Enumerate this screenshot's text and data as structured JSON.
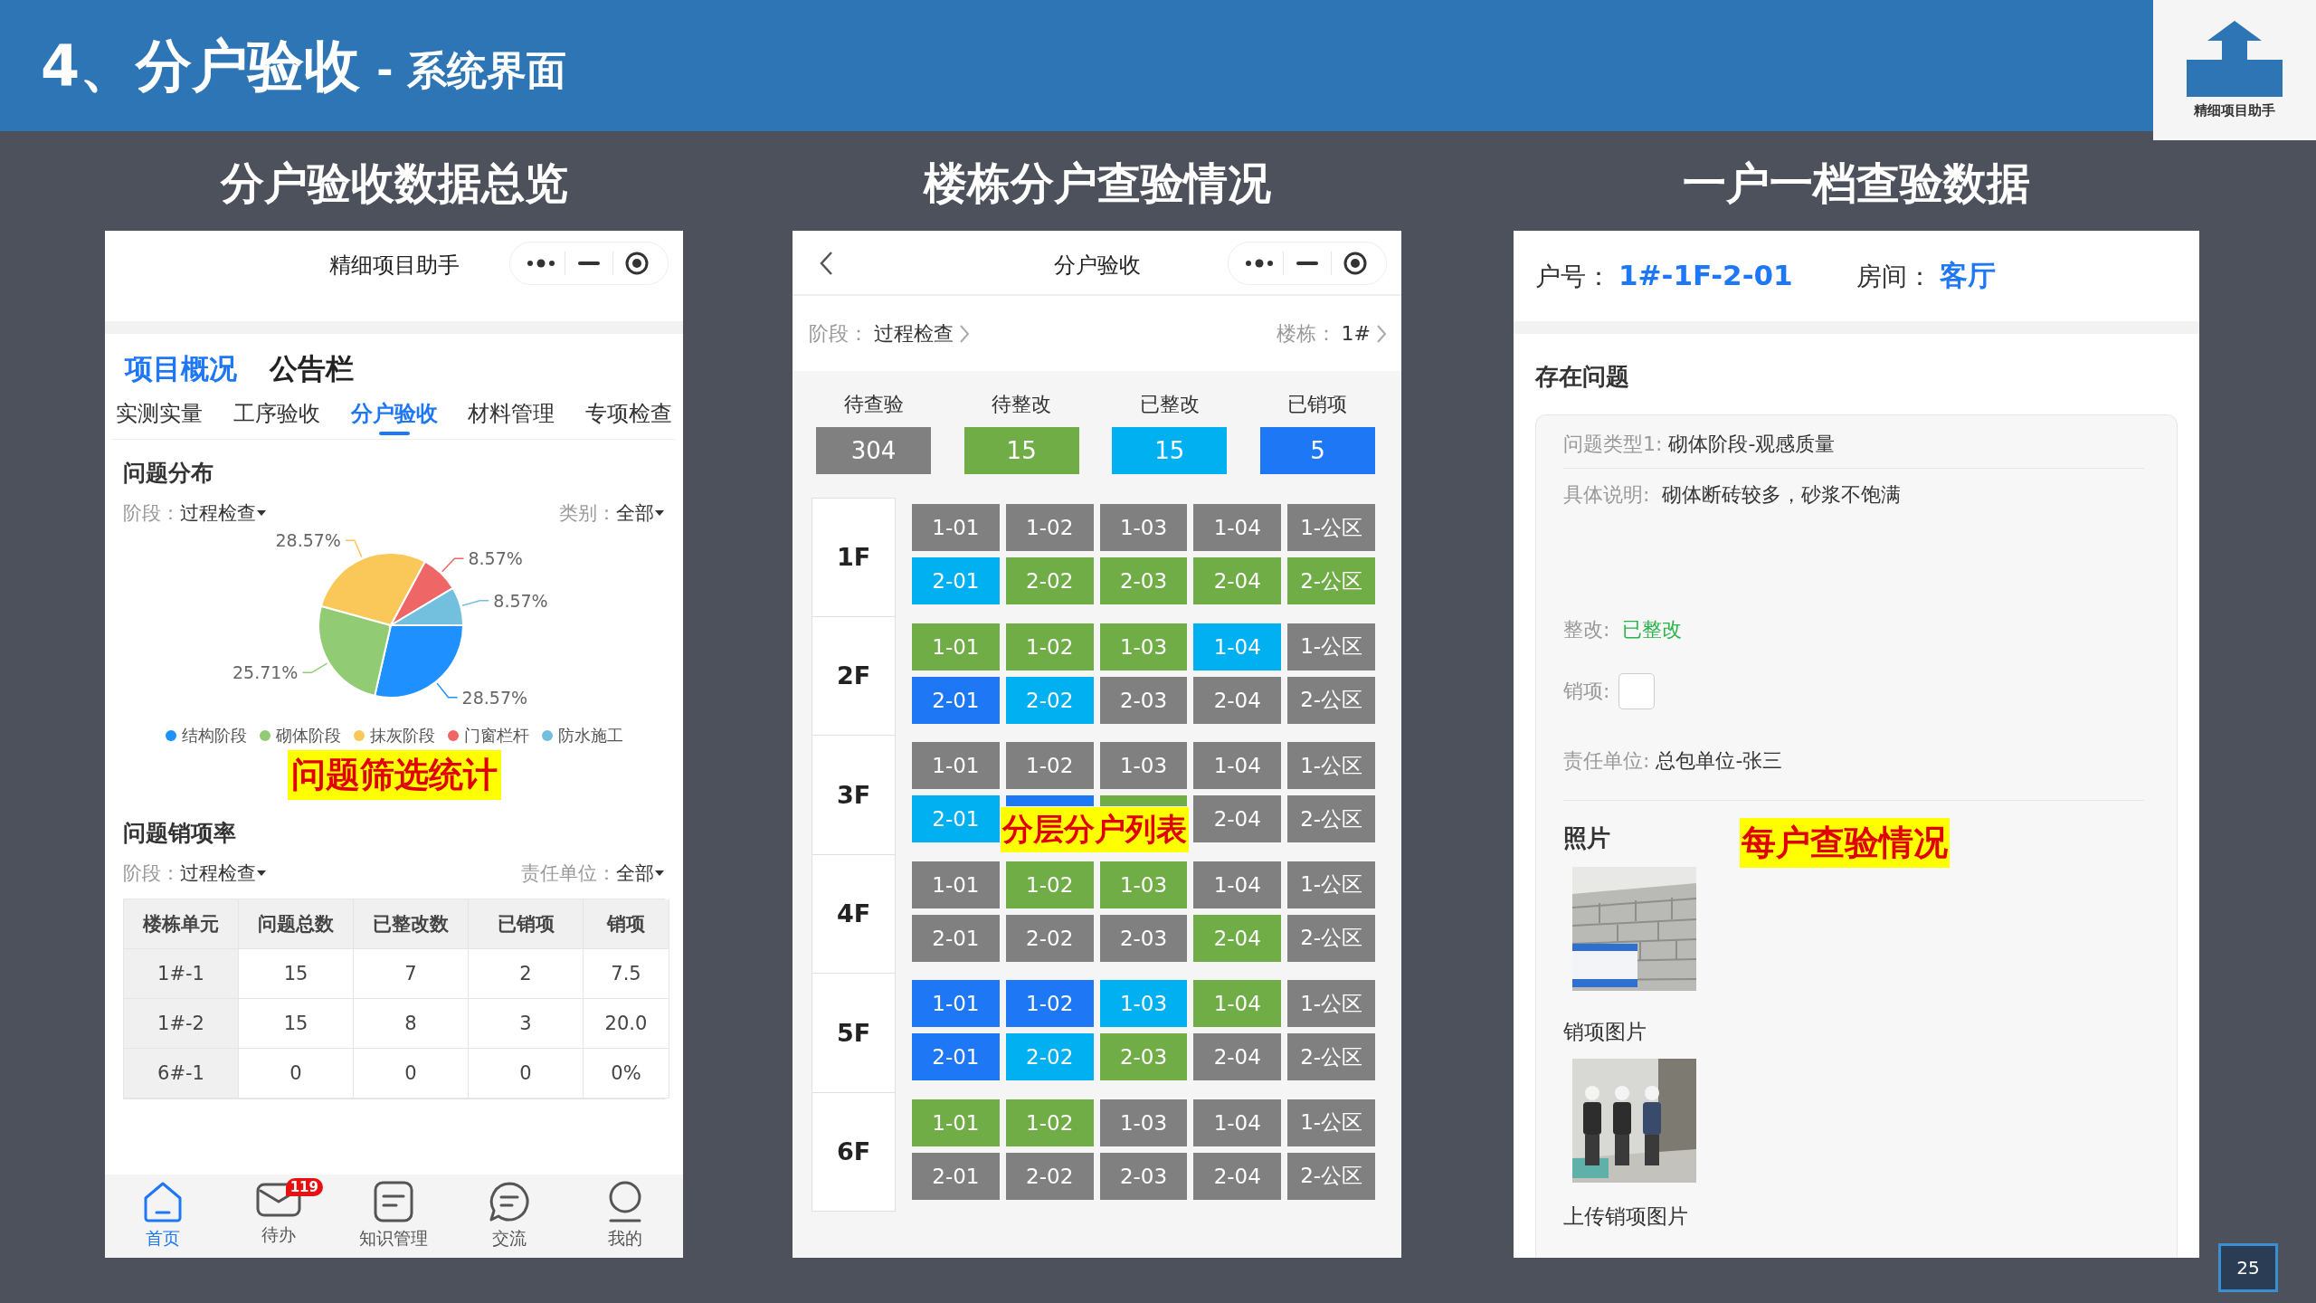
{
  "header": {
    "title": "4、分户验收",
    "subtitle": "- 系统界面"
  },
  "logo": {
    "caption": "精细项目助手"
  },
  "overview": {
    "heading": "分户验收数据总览",
    "app_title": "精细项目助手",
    "top_tabs": [
      {
        "label": "项目概况",
        "selected": true
      },
      {
        "label": "公告栏",
        "selected": false
      }
    ],
    "sub_tabs": [
      {
        "label": "实测实量",
        "selected": false
      },
      {
        "label": "工序验收",
        "selected": false
      },
      {
        "label": "分户验收",
        "selected": true
      },
      {
        "label": "材料管理",
        "selected": false
      },
      {
        "label": "专项检查",
        "selected": false
      }
    ],
    "distribution": {
      "title": "问题分布",
      "filters": [
        {
          "label": "阶段：",
          "value": "过程检查"
        },
        {
          "label": "类别：",
          "value": "全部"
        }
      ],
      "chart_data": {
        "type": "pie",
        "categories": [
          "结构阶段",
          "砌体阶段",
          "抹灰阶段",
          "门窗栏杆",
          "防水施工"
        ],
        "values": [
          28.57,
          25.71,
          28.57,
          8.57,
          8.57
        ],
        "colors": [
          "#1e90ff",
          "#91cc75",
          "#fac858",
          "#ee6666",
          "#73c0de"
        ],
        "value_labels": [
          "28.57%",
          "25.71%",
          "28.57%",
          "8.57%",
          "8.57%"
        ]
      }
    },
    "highlight": "问题筛选统计",
    "closure": {
      "title": "问题销项率",
      "filters": [
        {
          "label": "阶段：",
          "value": "过程检查"
        },
        {
          "label": "责任单位：",
          "value": "全部"
        }
      ],
      "columns": [
        "楼栋单元",
        "问题总数",
        "已整改数",
        "已销项",
        "销项"
      ],
      "rows": [
        [
          "1#-1",
          "15",
          "7",
          "2",
          "7.5"
        ],
        [
          "1#-2",
          "15",
          "8",
          "3",
          "20.0"
        ],
        [
          "6#-1",
          "0",
          "0",
          "0",
          "0%"
        ]
      ]
    },
    "nav": [
      {
        "label": "首页",
        "kind": "home",
        "selected": true
      },
      {
        "label": "待办",
        "kind": "mail",
        "selected": false,
        "badge": "119"
      },
      {
        "label": "知识管理",
        "kind": "doc",
        "selected": false
      },
      {
        "label": "交流",
        "kind": "chat",
        "selected": false
      },
      {
        "label": "我的",
        "kind": "user",
        "selected": false
      }
    ]
  },
  "building": {
    "heading": "楼栋分户查验情况",
    "app_title": "分户验收",
    "filters": [
      {
        "label": "阶段：",
        "value": "过程检查"
      },
      {
        "label": "楼栋：",
        "value": "1#"
      }
    ],
    "stats": [
      {
        "label": "待查验",
        "value": "304",
        "color": "#808080"
      },
      {
        "label": "待整改",
        "value": "15",
        "color": "#70ad47"
      },
      {
        "label": "已整改",
        "value": "15",
        "color": "#00b0f0"
      },
      {
        "label": "已销项",
        "value": "5",
        "color": "#1e78f5"
      }
    ],
    "floors": [
      {
        "name": "1F",
        "units": [
          {
            "label": "1-01",
            "color": "#808080"
          },
          {
            "label": "1-02",
            "color": "#808080"
          },
          {
            "label": "1-03",
            "color": "#808080"
          },
          {
            "label": "1-04",
            "color": "#808080"
          },
          {
            "label": "1-公区",
            "color": "#808080"
          },
          {
            "label": "2-01",
            "color": "#00b0f0"
          },
          {
            "label": "2-02",
            "color": "#70ad47"
          },
          {
            "label": "2-03",
            "color": "#70ad47"
          },
          {
            "label": "2-04",
            "color": "#70ad47"
          },
          {
            "label": "2-公区",
            "color": "#70ad47"
          }
        ]
      },
      {
        "name": "2F",
        "units": [
          {
            "label": "1-01",
            "color": "#70ad47"
          },
          {
            "label": "1-02",
            "color": "#70ad47"
          },
          {
            "label": "1-03",
            "color": "#70ad47"
          },
          {
            "label": "1-04",
            "color": "#00b0f0"
          },
          {
            "label": "1-公区",
            "color": "#808080"
          },
          {
            "label": "2-01",
            "color": "#1e78f5"
          },
          {
            "label": "2-02",
            "color": "#00b0f0"
          },
          {
            "label": "2-03",
            "color": "#808080"
          },
          {
            "label": "2-04",
            "color": "#808080"
          },
          {
            "label": "2-公区",
            "color": "#808080"
          }
        ]
      },
      {
        "name": "3F",
        "units": [
          {
            "label": "1-01",
            "color": "#808080"
          },
          {
            "label": "1-02",
            "color": "#808080"
          },
          {
            "label": "1-03",
            "color": "#808080"
          },
          {
            "label": "1-04",
            "color": "#808080"
          },
          {
            "label": "1-公区",
            "color": "#808080"
          },
          {
            "label": "2-01",
            "color": "#00b0f0"
          },
          {
            "color": "#1e78f5"
          },
          {
            "color": "#70ad47"
          },
          {
            "label": "2-04",
            "color": "#808080"
          },
          {
            "label": "2-公区",
            "color": "#808080"
          }
        ]
      },
      {
        "name": "4F",
        "units": [
          {
            "label": "1-01",
            "color": "#808080"
          },
          {
            "label": "1-02",
            "color": "#70ad47"
          },
          {
            "label": "1-03",
            "color": "#70ad47"
          },
          {
            "label": "1-04",
            "color": "#808080"
          },
          {
            "label": "1-公区",
            "color": "#808080"
          },
          {
            "label": "2-01",
            "color": "#808080"
          },
          {
            "label": "2-02",
            "color": "#808080"
          },
          {
            "label": "2-03",
            "color": "#808080"
          },
          {
            "label": "2-04",
            "color": "#70ad47"
          },
          {
            "label": "2-公区",
            "color": "#808080"
          }
        ]
      },
      {
        "name": "5F",
        "units": [
          {
            "label": "1-01",
            "color": "#1e78f5"
          },
          {
            "label": "1-02",
            "color": "#1e78f5"
          },
          {
            "label": "1-03",
            "color": "#00b0f0"
          },
          {
            "label": "1-04",
            "color": "#70ad47"
          },
          {
            "label": "1-公区",
            "color": "#808080"
          },
          {
            "label": "2-01",
            "color": "#1e78f5"
          },
          {
            "label": "2-02",
            "color": "#00b0f0"
          },
          {
            "label": "2-03",
            "color": "#70ad47"
          },
          {
            "label": "2-04",
            "color": "#808080"
          },
          {
            "label": "2-公区",
            "color": "#808080"
          }
        ]
      },
      {
        "name": "6F",
        "units": [
          {
            "label": "1-01",
            "color": "#70ad47"
          },
          {
            "label": "1-02",
            "color": "#70ad47"
          },
          {
            "label": "1-03",
            "color": "#808080"
          },
          {
            "label": "1-04",
            "color": "#808080"
          },
          {
            "label": "1-公区",
            "color": "#808080"
          },
          {
            "label": "2-01",
            "color": "#808080"
          },
          {
            "label": "2-02",
            "color": "#808080"
          },
          {
            "label": "2-03",
            "color": "#808080"
          },
          {
            "label": "2-04",
            "color": "#808080"
          },
          {
            "label": "2-公区",
            "color": "#808080"
          }
        ]
      }
    ],
    "highlight": "分层分户列表"
  },
  "household": {
    "heading": "一户一档查验数据",
    "unit": {
      "label": "户号：",
      "value": "1#-1F-2-01"
    },
    "room": {
      "label": "房间：",
      "value": "客厅"
    },
    "section_title": "存在问题",
    "issue_type": {
      "label": "问题类型1:",
      "value": "砌体阶段-观感质量"
    },
    "description": {
      "label": "具体说明:",
      "value": "砌体断砖较多，砂浆不饱满"
    },
    "rectification": {
      "label": "整改:",
      "value": "已整改"
    },
    "closure": {
      "label": "销项:",
      "checked": false
    },
    "responsible": {
      "label": "责任单位:",
      "value": "总包单位-张三"
    },
    "photos_title": "照片",
    "closure_photos_title": "销项图片",
    "upload_title": "上传销项图片",
    "highlight": "每户查验情况"
  },
  "page_number": "25"
}
